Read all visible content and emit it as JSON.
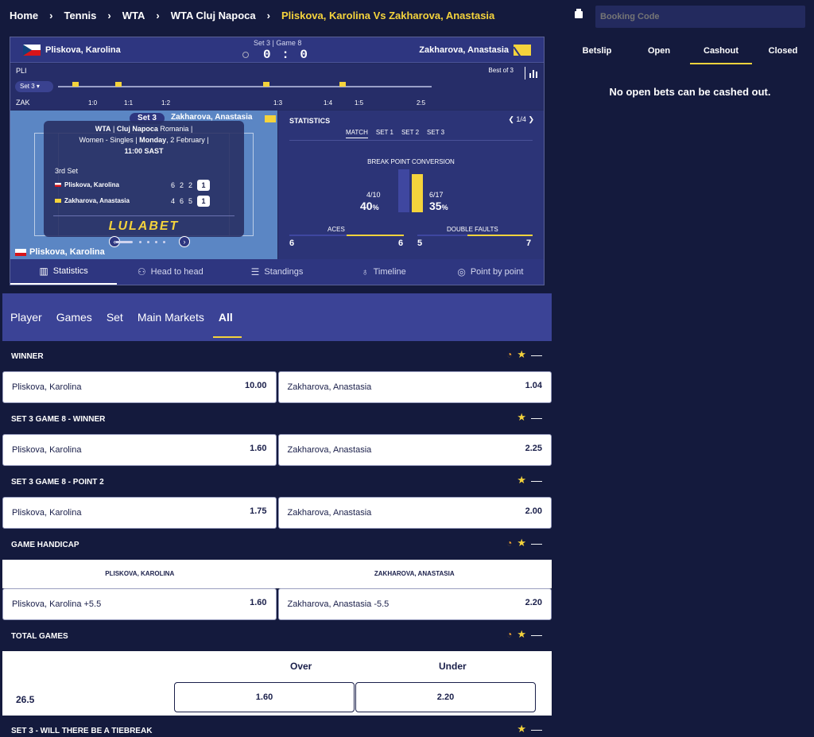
{
  "breadcrumb": [
    "Home",
    "Tennis",
    "WTA",
    "WTA Cluj Napoca",
    "Pliskova, Karolina Vs Zakharova, Anastasia"
  ],
  "scoreboard": {
    "player1": "Pliskova, Karolina",
    "player2": "Zakharova, Anastasia",
    "set_game": "Set 3 | Game 8",
    "score": "0 : 0",
    "p1_abbr": "PLI",
    "p2_abbr": "ZAK",
    "set_selector": "Set 3",
    "best_of": "Best of 3",
    "timeline_ticks": [
      "1:0",
      "1:1",
      "1:2",
      "1:3",
      "1:4",
      "1:5",
      "2:5"
    ],
    "set_tab": "Set 3",
    "info": {
      "tour": "WTA",
      "venue": "Cluj Napoca",
      "country": "Romania",
      "category": "Women - Singles",
      "day": "Monday",
      "date": "2 February",
      "time": "11:00 SAST",
      "set_label": "3rd Set",
      "p1_name": "Pliskova, Karolina",
      "p2_name": "Zakharova, Anastasia",
      "p1_sets": [
        "6",
        "2",
        "2",
        "1"
      ],
      "p2_sets": [
        "4",
        "6",
        "5",
        "1"
      ],
      "brand": "LULABET"
    },
    "stats": {
      "title": "STATISTICS",
      "pager": "1/4",
      "tabs": [
        "MATCH",
        "SET 1",
        "SET 2",
        "SET 3"
      ],
      "bpc_title": "BREAK POINT CONVERSION",
      "bpc_left_ratio": "4/10",
      "bpc_left_pct": "40",
      "bpc_right_ratio": "6/17",
      "bpc_right_pct": "35",
      "pct_sign": "%",
      "aces_label": "ACES",
      "aces_p1": "6",
      "aces_p2": "6",
      "df_label": "DOUBLE FAULTS",
      "df_p1": "5",
      "df_p2": "7"
    },
    "tabs": [
      "Statistics",
      "Head to head",
      "Standings",
      "Timeline",
      "Point by point"
    ]
  },
  "market_tabs": [
    "Player",
    "Games",
    "Set",
    "Main Markets",
    "All"
  ],
  "markets": {
    "winner": {
      "title": "WINNER",
      "p1": "Pliskova, Karolina",
      "p1_odds": "10.00",
      "p2": "Zakharova, Anastasia",
      "p2_odds": "1.04"
    },
    "s3g8": {
      "title": "SET 3 GAME 8 - WINNER",
      "p1": "Pliskova, Karolina",
      "p1_odds": "1.60",
      "p2": "Zakharova, Anastasia",
      "p2_odds": "2.25"
    },
    "s3g8p2": {
      "title": "SET 3 GAME 8 - POINT 2",
      "p1": "Pliskova, Karolina",
      "p1_odds": "1.75",
      "p2": "Zakharova, Anastasia",
      "p2_odds": "2.00"
    },
    "handicap": {
      "title": "GAME HANDICAP",
      "col1": "PLISKOVA, KAROLINA",
      "col2": "ZAKHAROVA, ANASTASIA",
      "p1": "Pliskova, Karolina +5.5",
      "p1_odds": "1.60",
      "p2": "Zakharova, Anastasia -5.5",
      "p2_odds": "2.20"
    },
    "total": {
      "title": "TOTAL GAMES",
      "over": "Over",
      "under": "Under",
      "line": "26.5",
      "over_odds": "1.60",
      "under_odds": "2.20"
    },
    "tiebreak": {
      "title": "SET 3 - WILL THERE BE A TIEBREAK"
    }
  },
  "betslip": {
    "booking_placeholder": "Booking Code",
    "tabs": [
      "Betslip",
      "Open",
      "Cashout",
      "Closed"
    ],
    "active_tab": "Cashout",
    "message": "No open bets can be cashed out."
  },
  "colors": {
    "accent": "#f4d33c",
    "background": "#141a3d",
    "panel": "#3b4396"
  }
}
